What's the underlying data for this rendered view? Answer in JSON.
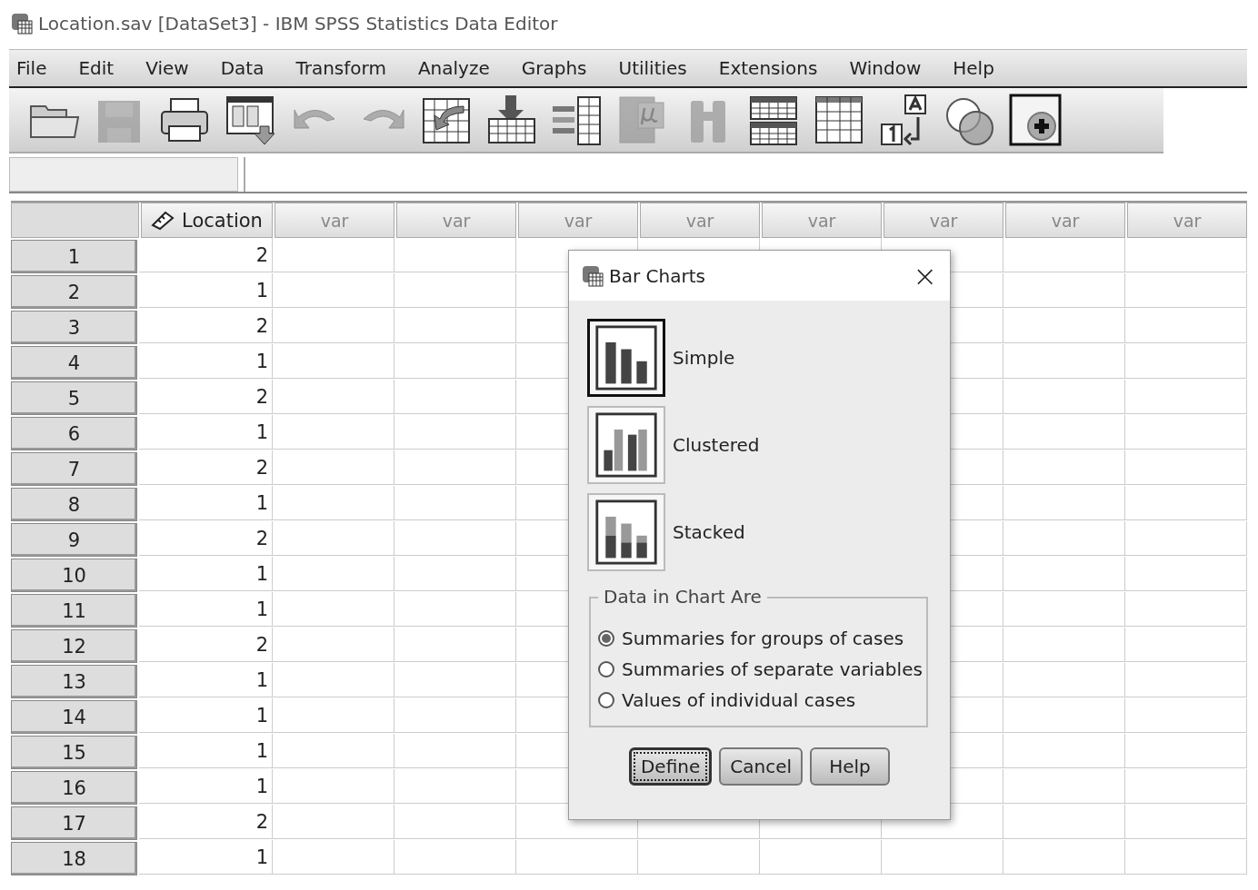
{
  "window": {
    "title": "Location.sav [DataSet3] - IBM SPSS Statistics Data Editor"
  },
  "menu": [
    "File",
    "Edit",
    "View",
    "Data",
    "Transform",
    "Analyze",
    "Graphs",
    "Utilities",
    "Extensions",
    "Window",
    "Help"
  ],
  "toolbar": [
    {
      "kind": "open",
      "disabled": false
    },
    {
      "kind": "save",
      "disabled": true
    },
    {
      "kind": "print",
      "disabled": false
    },
    {
      "kind": "recall",
      "disabled": false
    },
    {
      "kind": "undo",
      "disabled": true
    },
    {
      "kind": "redo",
      "disabled": true
    },
    {
      "kind": "goto",
      "disabled": false
    },
    {
      "kind": "gotovar",
      "disabled": false
    },
    {
      "kind": "variables",
      "disabled": false
    },
    {
      "kind": "mu",
      "disabled": true
    },
    {
      "kind": "find",
      "disabled": true
    },
    {
      "kind": "split",
      "disabled": false
    },
    {
      "kind": "select",
      "disabled": false
    },
    {
      "kind": "labels",
      "disabled": false
    },
    {
      "kind": "sets",
      "disabled": false
    },
    {
      "kind": "extension",
      "disabled": false
    }
  ],
  "table": {
    "columns": [
      {
        "name": "Location",
        "defined": true
      },
      {
        "name": "var",
        "defined": false
      },
      {
        "name": "var",
        "defined": false
      },
      {
        "name": "var",
        "defined": false
      },
      {
        "name": "var",
        "defined": false
      },
      {
        "name": "var",
        "defined": false
      },
      {
        "name": "var",
        "defined": false
      },
      {
        "name": "var",
        "defined": false
      },
      {
        "name": "var",
        "defined": false
      }
    ],
    "rows": [
      {
        "number": "1",
        "values": [
          "2"
        ]
      },
      {
        "number": "2",
        "values": [
          "1"
        ]
      },
      {
        "number": "3",
        "values": [
          "2"
        ]
      },
      {
        "number": "4",
        "values": [
          "1"
        ]
      },
      {
        "number": "5",
        "values": [
          "2"
        ]
      },
      {
        "number": "6",
        "values": [
          "1"
        ]
      },
      {
        "number": "7",
        "values": [
          "2"
        ]
      },
      {
        "number": "8",
        "values": [
          "1"
        ]
      },
      {
        "number": "9",
        "values": [
          "2"
        ]
      },
      {
        "number": "10",
        "values": [
          "1"
        ]
      },
      {
        "number": "11",
        "values": [
          "1"
        ]
      },
      {
        "number": "12",
        "values": [
          "2"
        ]
      },
      {
        "number": "13",
        "values": [
          "1"
        ]
      },
      {
        "number": "14",
        "values": [
          "1"
        ]
      },
      {
        "number": "15",
        "values": [
          "1"
        ]
      },
      {
        "number": "16",
        "values": [
          "1"
        ]
      },
      {
        "number": "17",
        "values": [
          "2"
        ]
      },
      {
        "number": "18",
        "values": [
          "1"
        ]
      }
    ]
  },
  "dialog": {
    "title": "Bar Charts",
    "close": "×",
    "chart_types": [
      {
        "kind": "simple",
        "label": "Simple",
        "selected": true
      },
      {
        "kind": "clustered",
        "label": "Clustered",
        "selected": false
      },
      {
        "kind": "stacked",
        "label": "Stacked",
        "selected": false
      }
    ],
    "group": {
      "title": "Data in Chart Are",
      "options": [
        {
          "label": "Summaries for groups of cases",
          "selected": true
        },
        {
          "label": "Summaries of separate variables",
          "selected": false
        },
        {
          "label": "Values of individual cases",
          "selected": false
        }
      ]
    },
    "buttons": [
      {
        "label": "Define",
        "default": true
      },
      {
        "label": "Cancel",
        "default": false
      },
      {
        "label": "Help",
        "default": false
      }
    ]
  }
}
